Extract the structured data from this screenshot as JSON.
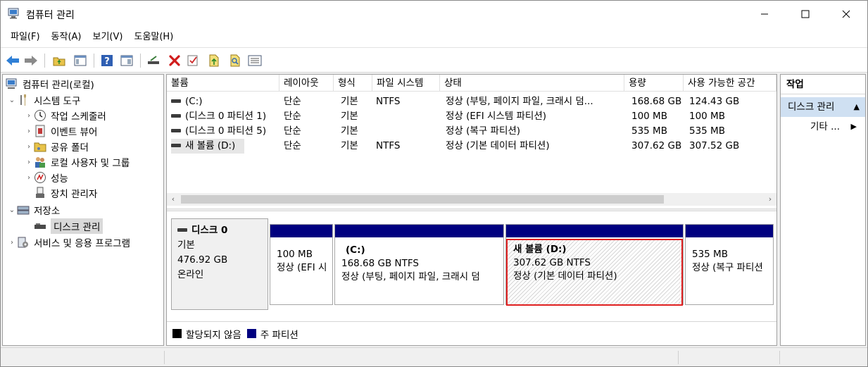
{
  "window": {
    "title": "컴퓨터 관리"
  },
  "menu": [
    "파일(F)",
    "동작(A)",
    "보기(V)",
    "도움말(H)"
  ],
  "tree": {
    "root": "컴퓨터 관리(로컬)",
    "items": [
      {
        "label": "시스템 도구",
        "icon": "tools-icon"
      },
      {
        "label": "작업 스케줄러",
        "icon": "clock-icon"
      },
      {
        "label": "이벤트 뷰어",
        "icon": "event-viewer-icon"
      },
      {
        "label": "공유 폴더",
        "icon": "shared-folder-icon"
      },
      {
        "label": "로컬 사용자 및 그룹",
        "icon": "users-icon"
      },
      {
        "label": "성능",
        "icon": "performance-icon"
      },
      {
        "label": "장치 관리자",
        "icon": "device-manager-icon"
      },
      {
        "label": "저장소",
        "icon": "storage-icon"
      },
      {
        "label": "디스크 관리",
        "icon": "disk-management-icon"
      },
      {
        "label": "서비스 및 응용 프로그램",
        "icon": "services-icon"
      }
    ]
  },
  "volumes": {
    "columns": [
      "볼륨",
      "레이아웃",
      "형식",
      "파일 시스템",
      "상태",
      "용량",
      "사용 가능한 공간"
    ],
    "rows": [
      [
        "(C:)",
        "단순",
        "기본",
        "NTFS",
        "정상 (부팅, 페이지 파일, 크래시 덤...",
        "168.68 GB",
        "124.43 GB"
      ],
      [
        "(디스크 0 파티션 1)",
        "단순",
        "기본",
        "",
        "정상 (EFI 시스템 파티션)",
        "100 MB",
        "100 MB"
      ],
      [
        "(디스크 0 파티션 5)",
        "단순",
        "기본",
        "",
        "정상 (복구 파티션)",
        "535 MB",
        "535 MB"
      ],
      [
        "새 볼륨 (D:)",
        "단순",
        "기본",
        "NTFS",
        "정상 (기본 데이터 파티션)",
        "307.62 GB",
        "307.52 GB"
      ]
    ]
  },
  "disk": {
    "name": "디스크 0",
    "type": "기본",
    "size": "476.92 GB",
    "status": "온라인",
    "partitions": [
      {
        "name": "",
        "size": "100 MB",
        "status": "정상 (EFI 시"
      },
      {
        "name": "(C:)",
        "size": "168.68 GB NTFS",
        "status": "정상 (부팅, 페이지 파일, 크래시 덤"
      },
      {
        "name": "새 볼륨  (D:)",
        "size": "307.62 GB NTFS",
        "status": "정상 (기본 데이터 파티션)"
      },
      {
        "name": "",
        "size": "535 MB",
        "status": "정상 (복구 파티션"
      }
    ]
  },
  "legend": {
    "unallocated": "할당되지 않음",
    "primary": "주 파티션"
  },
  "actions": {
    "header": "작업",
    "section": "디스크 관리",
    "more": "기타 ..."
  },
  "colors": {
    "primary_partition": "#000080",
    "unallocated": "#000000",
    "selection": "#e02020",
    "action_section": "#cfe0f2"
  }
}
